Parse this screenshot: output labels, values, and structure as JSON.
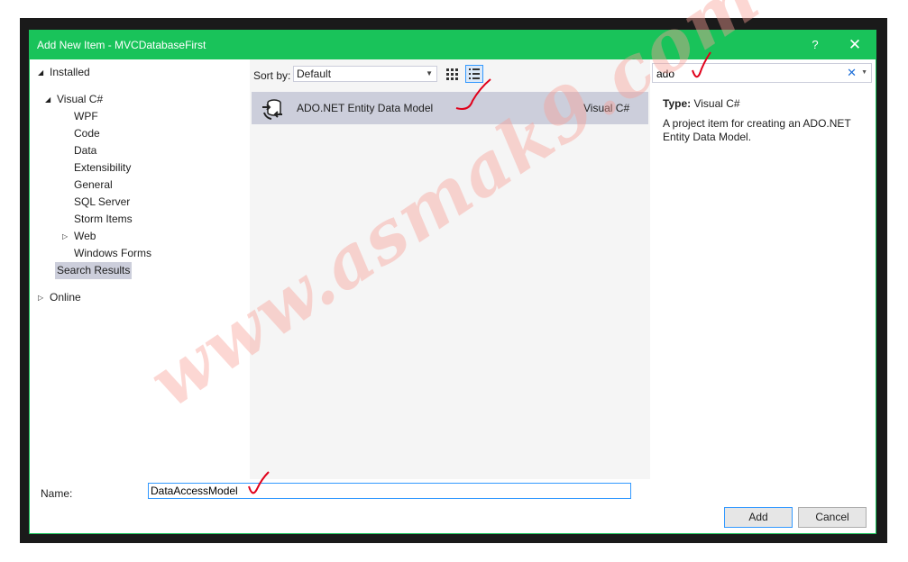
{
  "dialog": {
    "title": "Add New Item - MVCDatabaseFirst",
    "help_label": "?",
    "close_label": "✕"
  },
  "tree": {
    "installed": "Installed",
    "visual_csharp": "Visual C#",
    "items": [
      "WPF",
      "Code",
      "Data",
      "Extensibility",
      "General",
      "SQL Server",
      "Storm Items",
      "Web",
      "Windows Forms"
    ],
    "search_results": "Search Results",
    "online": "Online"
  },
  "toolbar": {
    "sort_by_label": "Sort by:",
    "sort_value": "Default"
  },
  "templates": [
    {
      "name": "ADO.NET Entity Data Model",
      "language": "Visual C#"
    }
  ],
  "search": {
    "value": "ado"
  },
  "details": {
    "type_label": "Type:",
    "type_value": "Visual C#",
    "description": "A project item for creating an ADO.NET Entity Data Model."
  },
  "bottom": {
    "name_label": "Name:",
    "name_value": "DataAccessModel",
    "add_label": "Add",
    "cancel_label": "Cancel"
  },
  "watermark": {
    "text": "www.asmak9.com",
    "color": "#f7c0b8"
  },
  "colors": {
    "titlebar": "#19c35a",
    "selection": "#cccedb",
    "focus": "#3399ff",
    "annotation": "#e0001a"
  }
}
